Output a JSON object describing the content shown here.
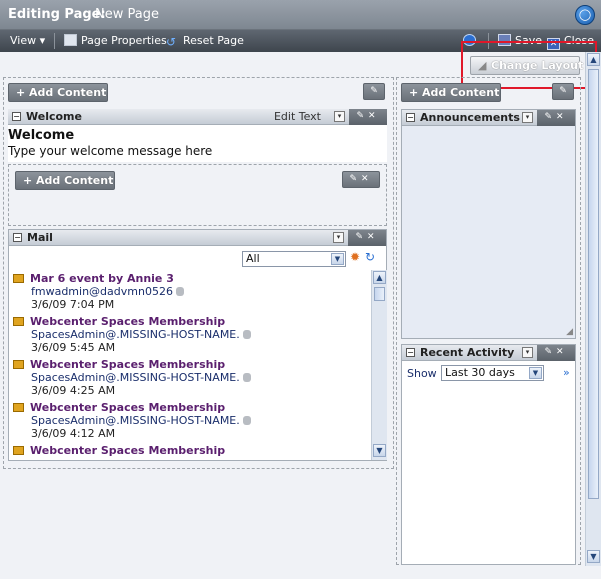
{
  "header": {
    "title_label": "Editing Page:",
    "title_page": "New Page"
  },
  "toolbar": {
    "view": "View",
    "page_properties": "Page Properties",
    "reset_page": "Reset Page",
    "save": "Save",
    "close": "Close"
  },
  "layout": {
    "change_layout": "Change Layout",
    "add_content": "Add Content"
  },
  "welcome": {
    "title": "Welcome",
    "edit_text": "Edit Text",
    "heading": "Welcome",
    "body": "Type your welcome message here"
  },
  "mail": {
    "title": "Mail",
    "filter": "All",
    "items": [
      {
        "subject": "Mar 6 event by Annie 3",
        "from": "fmwadmin@dadvmn0526",
        "date": "3/6/09 7:04 PM",
        "icon": "attachment-icon"
      },
      {
        "subject": "Webcenter Spaces Membership",
        "from": "SpacesAdmin@.MISSING-HOST-NAME.",
        "date": "3/6/09 5:45 AM",
        "icon": "mail-icon"
      },
      {
        "subject": "Webcenter Spaces Membership",
        "from": "SpacesAdmin@.MISSING-HOST-NAME.",
        "date": "3/6/09 4:25 AM",
        "icon": "mail-icon"
      },
      {
        "subject": "Webcenter Spaces Membership",
        "from": "SpacesAdmin@.MISSING-HOST-NAME.",
        "date": "3/6/09 4:12 AM",
        "icon": "mail-icon"
      },
      {
        "subject": "Webcenter Spaces Membership",
        "from": "",
        "date": "",
        "icon": "mail-icon"
      }
    ]
  },
  "announcements": {
    "title": "Announcements"
  },
  "recent_activity": {
    "title": "Recent Activity",
    "show_label": "Show",
    "period": "Last 30 days"
  },
  "colors": {
    "highlight": "#e0182a",
    "mail_subject": "#5a1f6e",
    "title_bar": "#8a929c"
  }
}
